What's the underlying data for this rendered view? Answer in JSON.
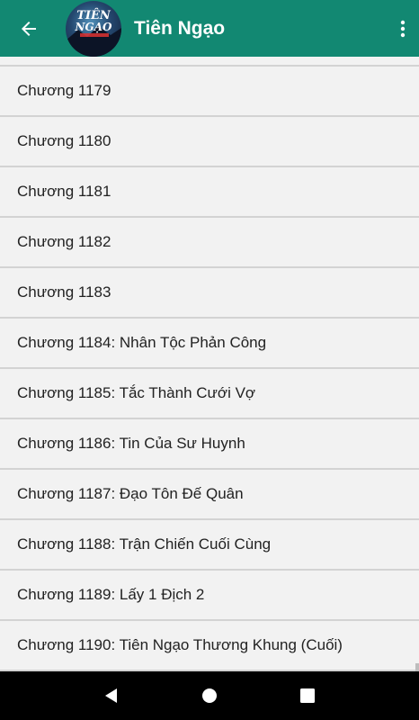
{
  "appbar": {
    "title": "Tiên Ngạo",
    "back_icon": "arrow-left-icon",
    "menu_icon": "more-vert-icon",
    "avatar_text": [
      "TIÊN",
      "NGẠO"
    ],
    "background_color": "#128872"
  },
  "chapters": [
    "Chương 1179",
    "Chương 1180",
    "Chương 1181",
    "Chương 1182",
    "Chương 1183",
    "Chương 1184: Nhân Tộc Phản Công",
    "Chương 1185: Tắc Thành Cưới Vợ",
    "Chương 1186: Tin Của Sư Huynh",
    "Chương 1187: Đạo Tôn Đế Quân",
    "Chương 1188: Trận Chiến Cuối Cùng",
    "Chương 1189: Lấy 1 Địch 2",
    "Chương 1190: Tiên Ngạo Thương Khung (Cuối)"
  ],
  "navbar": {
    "back_icon": "triangle-back-icon",
    "home_icon": "circle-home-icon",
    "recents_icon": "square-recents-icon"
  }
}
